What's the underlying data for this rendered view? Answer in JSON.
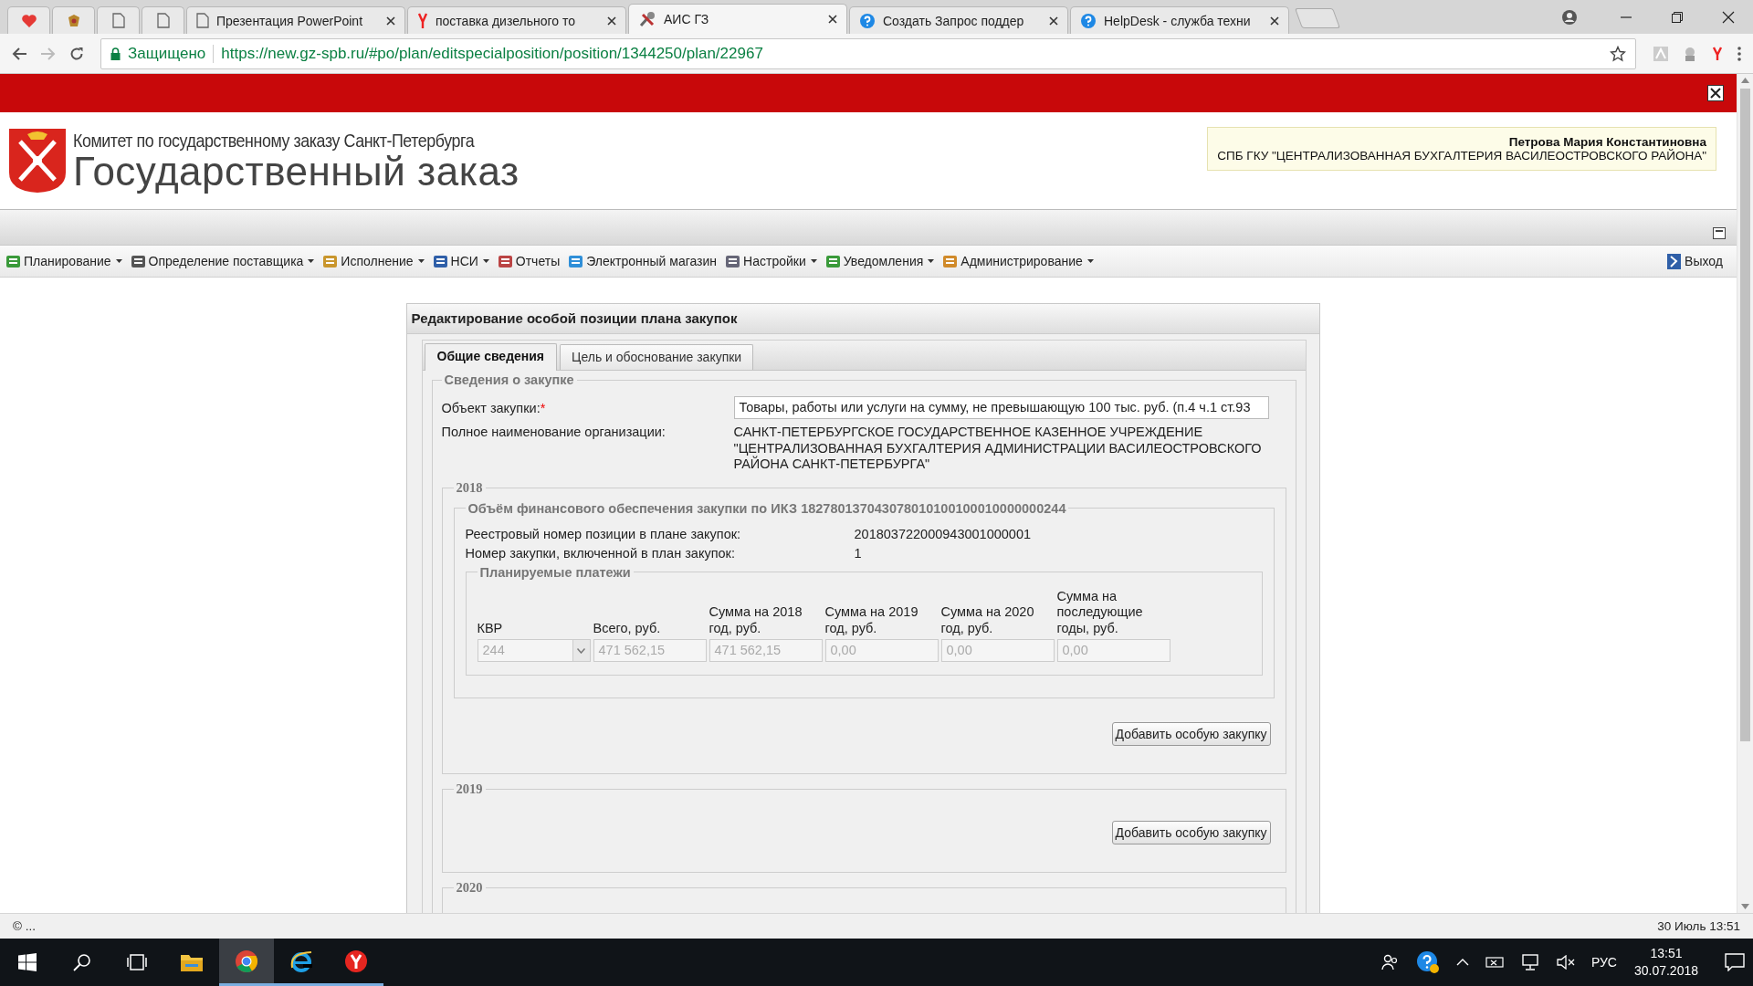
{
  "browser": {
    "tabs": [
      {
        "kind": "pinned",
        "selected": false
      },
      {
        "kind": "pinned",
        "selected": false
      },
      {
        "kind": "pinned",
        "selected": false
      },
      {
        "kind": "pinned",
        "selected": false
      },
      {
        "kind": "normal",
        "label": "Презентация PowerPoint",
        "selected": false
      },
      {
        "kind": "normal",
        "label": "поставка дизельного то",
        "selected": false
      },
      {
        "kind": "normal",
        "label": "АИС ГЗ",
        "selected": true
      },
      {
        "kind": "normal",
        "label": "Создать Запрос поддер",
        "selected": false
      },
      {
        "kind": "normal",
        "label": "HelpDesk - служба техни",
        "selected": false
      }
    ],
    "secure_label": "Защищено",
    "url_scheme": "https://",
    "url_host": "new.gz-spb.ru",
    "url_path": "/#po/plan/editspecialposition/position/1344250/plan/22967"
  },
  "header": {
    "committee": "Комитет по государственному заказу Санкт-Петербурга",
    "title": "Государственный заказ",
    "user_name": "Петрова Мария Константиновна",
    "user_org": "СПБ ГКУ \"ЦЕНТРАЛИЗОВАННАЯ БУХГАЛТЕРИЯ ВАСИЛЕОСТРОВСКОГО РАЙОНА\""
  },
  "menu": {
    "items": [
      {
        "label": "Планирование",
        "has_dropdown": true
      },
      {
        "label": "Определение поставщика",
        "has_dropdown": true
      },
      {
        "label": "Исполнение",
        "has_dropdown": true
      },
      {
        "label": "НСИ",
        "has_dropdown": true
      },
      {
        "label": "Отчеты",
        "has_dropdown": false
      },
      {
        "label": "Электронный магазин",
        "has_dropdown": false
      },
      {
        "label": "Настройки",
        "has_dropdown": true
      },
      {
        "label": "Уведомления",
        "has_dropdown": true
      },
      {
        "label": "Администрирование",
        "has_dropdown": true
      }
    ],
    "exit": "Выход"
  },
  "dialog": {
    "title": "Редактирование особой позиции плана закупок",
    "tabs": [
      {
        "label": "Общие сведения",
        "selected": true
      },
      {
        "label": "Цель и обоснование закупки",
        "selected": false
      }
    ],
    "section": "Сведения о закупке",
    "object_label": "Объект закупки:",
    "required_mark": "*",
    "object_value": "Товары, работы или услуги на сумму, не превышающую 100 тыс. руб. (п.4 ч.1 ст.93",
    "org_label": "Полное наименование организации:",
    "org_value": "САНКТ-ПЕТЕРБУРГСКОЕ ГОСУДАРСТВЕННОЕ КАЗЕННОЕ УЧРЕЖДЕНИЕ \"ЦЕНТРАЛИЗОВАННАЯ БУХГАЛТЕРИЯ АДМИНИСТРАЦИИ ВАСИЛЕОСТРОВСКОГО РАЙОНА САНКТ-ПЕТЕРБУРГА\"",
    "years": [
      {
        "year": "2018",
        "funding": {
          "title": "Объём финансового обеспечения закупки по ИКЗ 182780137043078010100100010000000244",
          "rows": [
            {
              "label": "Реестровый номер позиции в плане закупок:",
              "value": "201803722000943001000001"
            },
            {
              "label": "Номер закупки, включенной в план закупок:",
              "value": "1"
            }
          ],
          "payments": {
            "title": "Планируемые платежи",
            "columns": [
              "КВР",
              "Всего, руб.",
              "Сумма на 2018 год, руб.",
              "Сумма на 2019 год, руб.",
              "Сумма на 2020 год, руб.",
              "Сумма на последующие годы, руб."
            ],
            "disabled": true,
            "kvr": "244",
            "values": [
              "471 562,15",
              "471 562,15",
              "0,00",
              "0,00",
              "0,00"
            ]
          }
        },
        "button": "Добавить особую закупку"
      },
      {
        "year": "2019",
        "button": "Добавить особую закупку"
      },
      {
        "year": "2020"
      }
    ]
  },
  "status_bar": {
    "left": "© ...",
    "right": "30 Июль 13:51"
  },
  "taskbar": {
    "lang": "РУС",
    "time": "13:51",
    "date": "30.07.2018"
  }
}
